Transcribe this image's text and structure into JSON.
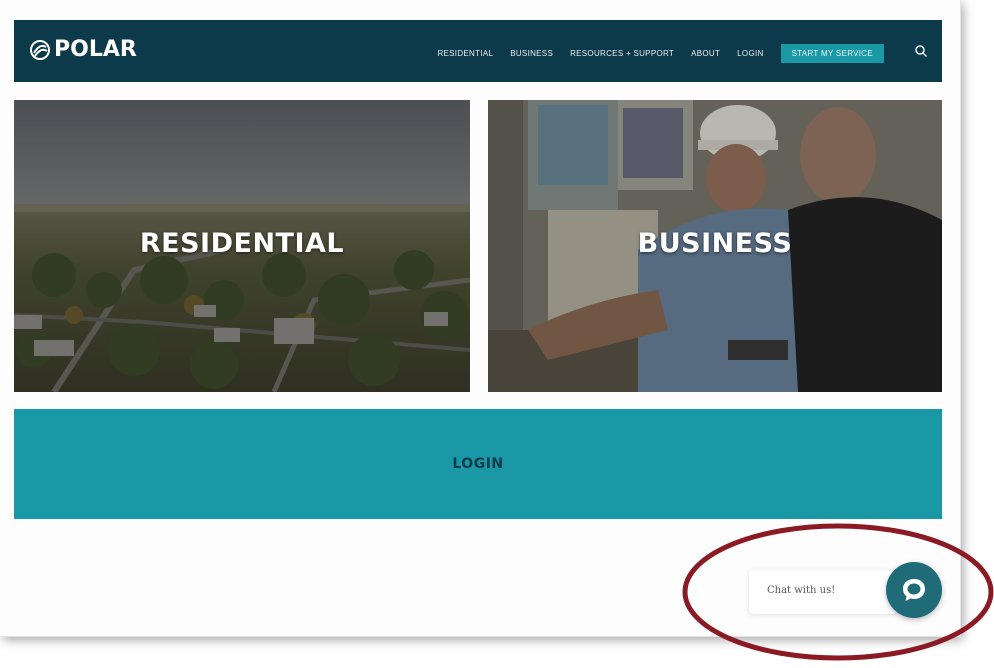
{
  "header": {
    "logo_text": "POLAR",
    "background_color": "#0d3a4b",
    "nav": [
      {
        "label": "RESIDENTIAL"
      },
      {
        "label": "BUSINESS"
      },
      {
        "label": "RESOURCES + SUPPORT"
      },
      {
        "label": "ABOUT"
      },
      {
        "label": "LOGIN"
      }
    ],
    "cta_label": "START MY SERVICE",
    "cta_color": "#1b98a6",
    "search_icon": "search-icon"
  },
  "tiles": {
    "residential_label": "RESIDENTIAL",
    "business_label": "BUSINESS"
  },
  "login_band": {
    "label": "LOGIN",
    "background_color": "#1b98a6"
  },
  "chat": {
    "prompt": "Chat with us!",
    "icon": "chat-bubble-icon",
    "button_color": "#1f6b78"
  },
  "annotation": {
    "shape": "ellipse",
    "color": "#8b1a24"
  }
}
